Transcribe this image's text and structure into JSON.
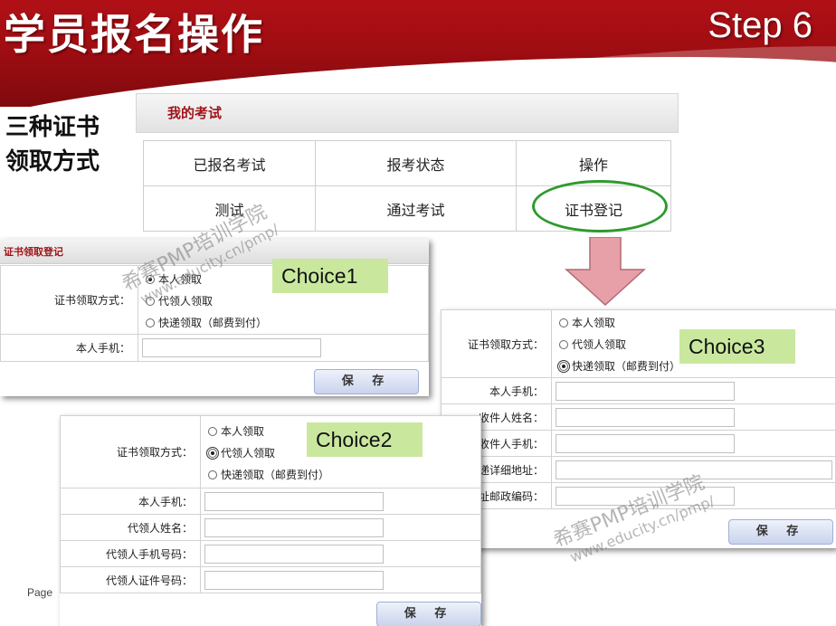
{
  "slide": {
    "title": "学员报名操作",
    "step": "Step 6",
    "caption_line1": "三种证书",
    "caption_line2": "领取方式",
    "footer": "Page"
  },
  "my_exam": {
    "header": "我的考试",
    "columns": [
      "已报名考试",
      "报考状态",
      "操作"
    ],
    "row": [
      "测试",
      "通过考试",
      "证书登记"
    ]
  },
  "choice1": {
    "header": "证书领取登记",
    "tag": "Choice1",
    "method_label": "证书领取方式：",
    "options": [
      "本人领取",
      "代领人领取",
      "快递领取（邮费到付）"
    ],
    "selected_index": 0,
    "phone_label": "本人手机：",
    "save": "保 存"
  },
  "choice2": {
    "tag": "Choice2",
    "method_label": "证书领取方式：",
    "options": [
      "本人领取",
      "代领人领取",
      "快递领取（邮费到付）"
    ],
    "selected_index": 1,
    "fields": [
      "本人手机：",
      "代领人姓名：",
      "代领人手机号码：",
      "代领人证件号码："
    ],
    "save": "保 存"
  },
  "choice3": {
    "tag": "Choice3",
    "method_label": "证书领取方式：",
    "options": [
      "本人领取",
      "代领人领取",
      "快递领取（邮费到付）"
    ],
    "selected_index": 2,
    "fields": [
      "本人手机：",
      "收件人姓名：",
      "收件人手机：",
      "快递详细地址：",
      "快递地址邮政编码："
    ],
    "save": "保 存"
  },
  "watermark": {
    "name": "希赛PMP培训学院",
    "url": "www.educity.cn/pmp/"
  },
  "colors": {
    "header_red": "#a00d12",
    "tag_green": "#c9e89e",
    "ellipse_green": "#2e9a2e",
    "arrow_pink": "#e8a0a8"
  }
}
